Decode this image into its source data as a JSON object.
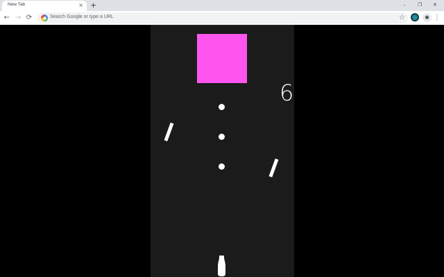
{
  "browser": {
    "tab_title": "New Tab",
    "tab_close": "×",
    "new_tab": "+",
    "window_controls": {
      "minimize": "–",
      "restore": "❐",
      "close": "✕"
    },
    "nav": {
      "back": "←",
      "forward": "→",
      "reload": "⟳"
    },
    "omnibox_placeholder": "Search Google or type a URL",
    "bookmark_star": "☆",
    "extensions": "✱",
    "menu": "⋮"
  },
  "game": {
    "score": "6",
    "colors": {
      "background": "#000000",
      "playfield": "#1b1b1b",
      "target": "#ff55ee",
      "objects": "#ffffff"
    }
  }
}
